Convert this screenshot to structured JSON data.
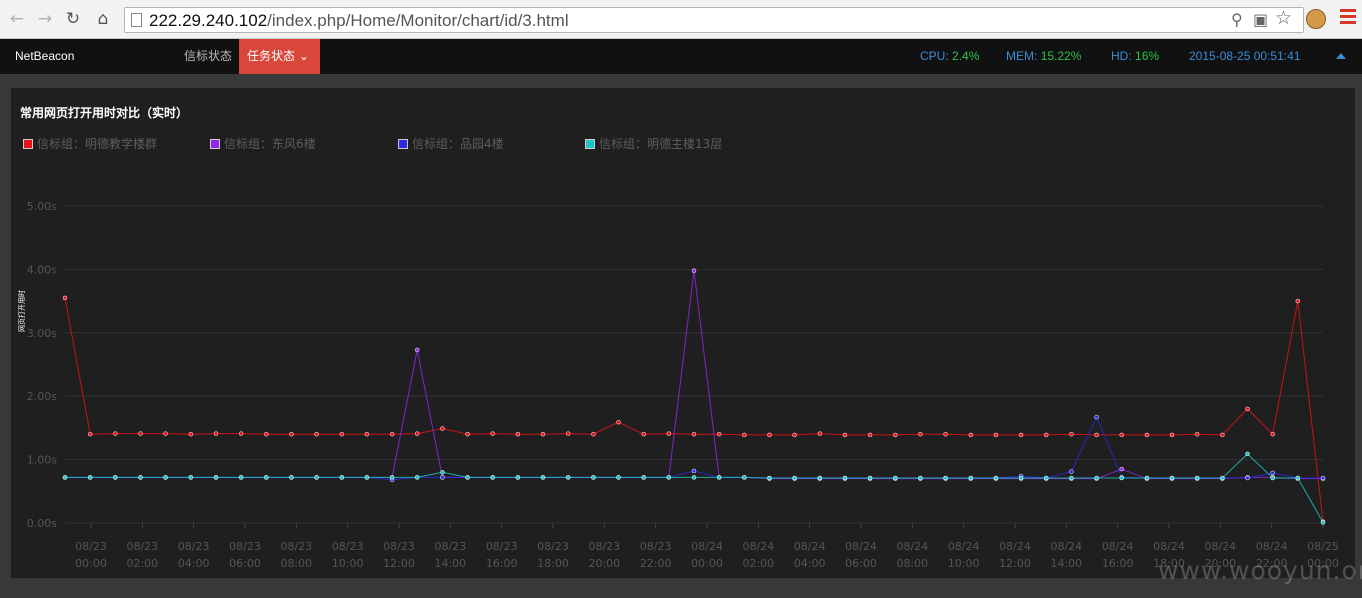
{
  "browser": {
    "url_host": "222.29.240.102",
    "url_path": "/index.php/Home/Monitor/chart/id/3.html",
    "back_icon": "arrow-left-icon",
    "forward_icon": "arrow-right-icon",
    "reload_icon": "reload-icon",
    "home_icon": "home-icon"
  },
  "nav": {
    "brand": "NetBeacon",
    "items": [
      {
        "label": "信标状态",
        "active": false
      },
      {
        "label": "任务状态 ⌄",
        "active": true
      }
    ],
    "cpu_label": "CPU:",
    "cpu_value": "2.4%",
    "mem_label": "MEM:",
    "mem_value": "15.22%",
    "hd_label": "HD:",
    "hd_value": "16%",
    "datetime": "2015-08-25 00:51:41"
  },
  "watermark": "www.wooyun.org",
  "chart_data": {
    "type": "line",
    "title": "常用网页打开用时对比（实时）",
    "ylabel": "网页打开用时",
    "ylim": [
      0,
      5
    ],
    "yticks": [
      "0.00s",
      "1.00s",
      "2.00s",
      "3.00s",
      "4.00s",
      "5.00s"
    ],
    "grid": true,
    "legend_position": "top-left",
    "x_tick_labels": [
      [
        "08/23",
        "00:00"
      ],
      [
        "08/23",
        "02:00"
      ],
      [
        "08/23",
        "04:00"
      ],
      [
        "08/23",
        "06:00"
      ],
      [
        "08/23",
        "08:00"
      ],
      [
        "08/23",
        "10:00"
      ],
      [
        "08/23",
        "12:00"
      ],
      [
        "08/23",
        "14:00"
      ],
      [
        "08/23",
        "16:00"
      ],
      [
        "08/23",
        "18:00"
      ],
      [
        "08/23",
        "20:00"
      ],
      [
        "08/23",
        "22:00"
      ],
      [
        "08/24",
        "00:00"
      ],
      [
        "08/24",
        "02:00"
      ],
      [
        "08/24",
        "04:00"
      ],
      [
        "08/24",
        "06:00"
      ],
      [
        "08/24",
        "08:00"
      ],
      [
        "08/24",
        "10:00"
      ],
      [
        "08/24",
        "12:00"
      ],
      [
        "08/24",
        "14:00"
      ],
      [
        "08/24",
        "16:00"
      ],
      [
        "08/24",
        "18:00"
      ],
      [
        "08/24",
        "20:00"
      ],
      [
        "08/24",
        "22:00"
      ],
      [
        "08/25",
        "00:00"
      ]
    ],
    "x_step_hours": 1,
    "series": [
      {
        "name": "信标组：明德教学楼群",
        "color": "#e8101a",
        "values": [
          3.55,
          1.4,
          1.41,
          1.41,
          1.41,
          1.4,
          1.41,
          1.41,
          1.4,
          1.4,
          1.4,
          1.4,
          1.4,
          1.4,
          1.41,
          1.49,
          1.4,
          1.41,
          1.4,
          1.4,
          1.41,
          1.4,
          1.59,
          1.4,
          1.41,
          1.4,
          1.4,
          1.39,
          1.39,
          1.39,
          1.41,
          1.39,
          1.39,
          1.39,
          1.4,
          1.4,
          1.39,
          1.39,
          1.39,
          1.39,
          1.4,
          1.39,
          1.39,
          1.39,
          1.39,
          1.4,
          1.39,
          1.8,
          1.4,
          3.5,
          0.02
        ]
      },
      {
        "name": "信标组：东风6楼",
        "color": "#8e28e6",
        "values": [
          0.72,
          0.72,
          0.72,
          0.72,
          0.72,
          0.72,
          0.72,
          0.72,
          0.72,
          0.72,
          0.72,
          0.72,
          0.72,
          0.72,
          2.73,
          0.72,
          0.72,
          0.72,
          0.72,
          0.72,
          0.72,
          0.72,
          0.72,
          0.72,
          0.72,
          3.98,
          0.72,
          0.72,
          0.7,
          0.7,
          0.7,
          0.7,
          0.7,
          0.7,
          0.7,
          0.7,
          0.7,
          0.7,
          0.7,
          0.7,
          0.7,
          0.7,
          0.85,
          0.7,
          0.7,
          0.7,
          0.7,
          0.72,
          0.72,
          0.7,
          0.7
        ]
      },
      {
        "name": "信标组：品园4楼",
        "color": "#2a2ae2",
        "values": [
          0.72,
          0.72,
          0.72,
          0.72,
          0.72,
          0.72,
          0.72,
          0.72,
          0.72,
          0.72,
          0.72,
          0.72,
          0.72,
          0.68,
          0.72,
          0.72,
          0.72,
          0.72,
          0.72,
          0.72,
          0.72,
          0.72,
          0.72,
          0.72,
          0.72,
          0.82,
          0.72,
          0.72,
          0.71,
          0.71,
          0.71,
          0.71,
          0.71,
          0.71,
          0.71,
          0.71,
          0.71,
          0.71,
          0.74,
          0.71,
          0.81,
          1.67,
          0.72,
          0.71,
          0.71,
          0.71,
          0.71,
          0.71,
          0.79,
          0.71,
          0.71
        ]
      },
      {
        "name": "信标组：明德主楼13层",
        "color": "#1ec3c0",
        "values": [
          0.72,
          0.72,
          0.72,
          0.72,
          0.72,
          0.72,
          0.72,
          0.72,
          0.72,
          0.72,
          0.72,
          0.72,
          0.72,
          0.72,
          0.72,
          0.8,
          0.72,
          0.72,
          0.72,
          0.72,
          0.72,
          0.72,
          0.72,
          0.72,
          0.72,
          0.72,
          0.72,
          0.72,
          0.71,
          0.71,
          0.71,
          0.71,
          0.71,
          0.71,
          0.71,
          0.71,
          0.71,
          0.71,
          0.71,
          0.71,
          0.71,
          0.71,
          0.71,
          0.71,
          0.71,
          0.71,
          0.71,
          1.09,
          0.71,
          0.71,
          0.01
        ]
      }
    ]
  }
}
